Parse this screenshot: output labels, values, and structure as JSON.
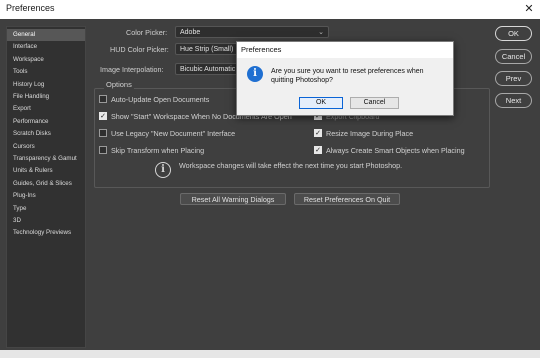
{
  "window": {
    "title": "Preferences",
    "close_glyph": "✕"
  },
  "sidebar": {
    "items": [
      {
        "label": "General",
        "selected": true
      },
      {
        "label": "Interface"
      },
      {
        "label": "Workspace"
      },
      {
        "label": "Tools"
      },
      {
        "label": "History Log"
      },
      {
        "label": "File Handling"
      },
      {
        "label": "Export"
      },
      {
        "label": "Performance"
      },
      {
        "label": "Scratch Disks"
      },
      {
        "label": "Cursors"
      },
      {
        "label": "Transparency & Gamut"
      },
      {
        "label": "Units & Rulers"
      },
      {
        "label": "Guides, Grid & Slices"
      },
      {
        "label": "Plug-Ins"
      },
      {
        "label": "Type"
      },
      {
        "label": "3D"
      },
      {
        "label": "Technology Previews"
      }
    ]
  },
  "general": {
    "color_picker": {
      "label": "Color Picker:",
      "value": "Adobe"
    },
    "hud_color_picker": {
      "label": "HUD Color Picker:",
      "value": "Hue Strip (Small)"
    },
    "image_interpolation": {
      "label": "Image Interpolation:",
      "value": "Bicubic Automatic"
    },
    "options_title": "Options",
    "options": {
      "auto_update": {
        "label": "Auto-Update Open Documents",
        "checked": false
      },
      "show_start": {
        "label": "Show \"Start\" Workspace When No Documents Are Open",
        "checked": true
      },
      "legacy_new_doc": {
        "label": "Use Legacy \"New Document\" Interface",
        "checked": false
      },
      "skip_transform": {
        "label": "Skip Transform when Placing",
        "checked": false
      },
      "export_clipboard": {
        "label": "Export Clipboard",
        "checked": true
      },
      "resize_image": {
        "label": "Resize Image During Place",
        "checked": true
      },
      "smart_objects": {
        "label": "Always Create Smart Objects when Placing",
        "checked": true
      }
    },
    "workspace_note": "Workspace changes will take effect the next time you start Photoshop.",
    "reset_warning_dialogs": "Reset All Warning Dialogs",
    "reset_prefs_on_quit": "Reset Preferences On Quit"
  },
  "right_buttons": {
    "ok": "OK",
    "cancel": "Cancel",
    "prev": "Prev",
    "next": "Next"
  },
  "dialog": {
    "title": "Preferences",
    "message": "Are you sure you want to reset preferences when quitting Photoshop?",
    "ok": "OK",
    "cancel": "Cancel",
    "icon_glyph": "i"
  },
  "check_glyph": "✓",
  "colors": {
    "dialog_accent": "#1f6fd1",
    "panel_bg": "#3f3f3f"
  }
}
